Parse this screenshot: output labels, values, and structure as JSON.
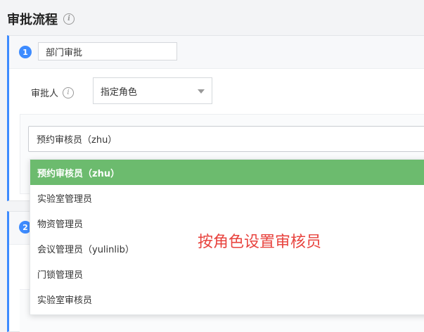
{
  "section": {
    "title": "审批流程"
  },
  "steps": [
    {
      "number": "1",
      "name": "部门审批"
    },
    {
      "number": "2"
    }
  ],
  "approver": {
    "label": "审批人",
    "mode_value": "指定角色"
  },
  "reviewer": {
    "selected_value": "预约审核员（zhu）",
    "options": [
      {
        "label": "预约审核员（zhu）",
        "selected": true
      },
      {
        "label": "实验室管理员"
      },
      {
        "label": "物资管理员"
      },
      {
        "label": "会议管理员（yulinlib）"
      },
      {
        "label": "门锁管理员"
      },
      {
        "label": "实验室审核员"
      }
    ]
  },
  "annotation": "按角色设置审核员",
  "colors": {
    "accent": "#3d8bff",
    "selected_option": "#6cbb6e",
    "annotation": "#e8443f"
  }
}
